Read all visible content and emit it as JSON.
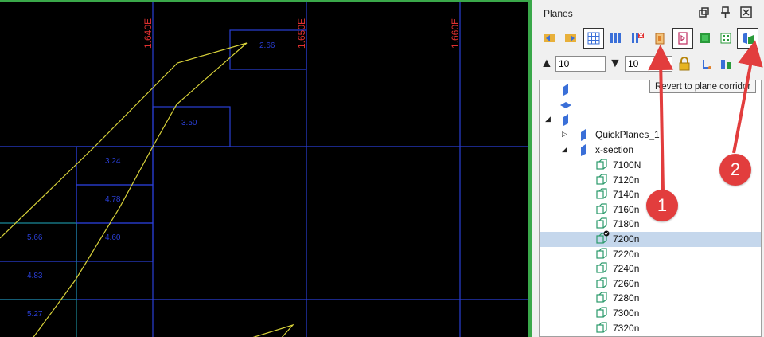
{
  "viewport": {
    "grid_labels": [
      "1.640E",
      "1.650E",
      "1.660E"
    ],
    "block_values": [
      "2.66",
      "3.50",
      "3.24",
      "4.78",
      "4.60",
      "5.66",
      "4.83",
      "5.27"
    ]
  },
  "panel": {
    "title": "Planes",
    "controls": [
      "restore-icon",
      "pin-icon",
      "close-icon"
    ],
    "toolbar": [
      "prev-plane-icon",
      "next-plane-icon",
      "grid-icon",
      "planes-icon",
      "delete-planes-icon",
      "plane-corridor-icon",
      "revert-plane-icon",
      "green-plane-icon",
      "small-grid-icon",
      "plane-section-icon"
    ],
    "up_value": "10",
    "down_value": "10",
    "tooltip": "Revert to plane corridor"
  },
  "tree": {
    "nodes": [
      {
        "label": "QuickPlanes_1"
      },
      {
        "label": "x-section"
      }
    ],
    "items": [
      "7100N",
      "7120n",
      "7140n",
      "7160n",
      "7180n",
      "7200n",
      "7220n",
      "7240n",
      "7260n",
      "7280n",
      "7300n",
      "7320n"
    ],
    "selected": "7200n"
  },
  "callouts": [
    "1",
    "2"
  ],
  "colors": {
    "accent_frame": "#3aa84a",
    "grid_line": "#2a3fd6",
    "label_red": "#e03030",
    "callout_red": "#e23d3d",
    "trace_yellow": "#d8d23a"
  }
}
